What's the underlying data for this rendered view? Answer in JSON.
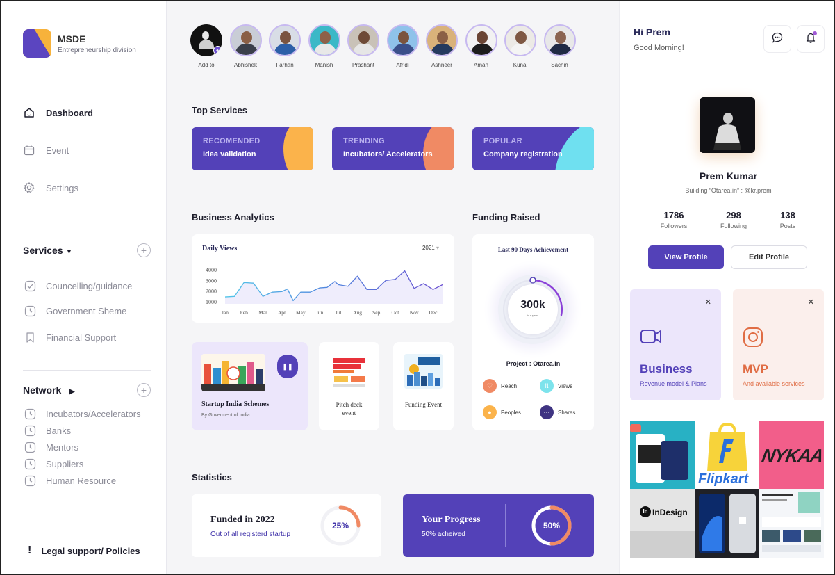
{
  "brand": {
    "title": "MSDE",
    "subtitle": "Entrepreneurship division"
  },
  "nav": {
    "dashboard": "Dashboard",
    "event": "Event",
    "settings": "Settings"
  },
  "services": {
    "title": "Services",
    "items": [
      "Councelling/guidance",
      "Government Sheme",
      "Financial Support"
    ]
  },
  "network": {
    "title": "Network",
    "items": [
      "Incubators/Accelerators",
      "Banks",
      "Mentors",
      "Suppliers",
      "Human Resource"
    ]
  },
  "legal": {
    "label": "Legal support/ Policies"
  },
  "stories": [
    "Add to",
    "Abhishek",
    "Farhan",
    "Manish",
    "Prashant",
    "Afridi",
    "Ashneer",
    "Aman",
    "Kunal",
    "Sachin"
  ],
  "top_services": {
    "title": "Top Services",
    "cards": [
      {
        "kind": "RECOMENDED",
        "value": "Idea validation"
      },
      {
        "kind": "TRENDING",
        "value": "Incubators/ Accelerators"
      },
      {
        "kind": "POPULAR",
        "value": "Company registration"
      }
    ]
  },
  "analytics": {
    "title": "Business Analytics"
  },
  "funding": {
    "title": "Funding Raised",
    "card_title": "Last 90 Days Achievement",
    "amount": "300k",
    "unit": "in rupees",
    "project": "Project : Otarea.in",
    "stats": [
      "Reach",
      "Views",
      "Peoples",
      "Shares"
    ]
  },
  "chart_data": {
    "type": "area",
    "title": "Daily Views",
    "year_selector": "2021",
    "x_ticks": [
      "Jan",
      "Feb",
      "Mar",
      "Apr",
      "May",
      "Jun",
      "Jul",
      "Aug",
      "Sep",
      "Oct",
      "Nov",
      "Dec"
    ],
    "y_ticks": [
      4000,
      3000,
      2000,
      1000
    ],
    "ylim": [
      800,
      4200
    ],
    "x": [
      0,
      0.5,
      1,
      1.5,
      2,
      2.5,
      3,
      3.3,
      3.6,
      4,
      4.5,
      5,
      5.4,
      5.8,
      6,
      6.5,
      7,
      7.5,
      8,
      8.5,
      9,
      9.5,
      10,
      10.5,
      11,
      11.5
    ],
    "values": [
      1450,
      1500,
      2800,
      2750,
      1500,
      1900,
      1950,
      2200,
      1100,
      1900,
      1900,
      2300,
      2350,
      2900,
      2600,
      2450,
      3400,
      2150,
      2150,
      3000,
      3100,
      3900,
      2250,
      2700,
      2150,
      2600
    ],
    "grid": false,
    "legend": "none"
  },
  "media": {
    "scheme_title": "Startup India Schemes",
    "scheme_sub": "By Goverment of India",
    "pitch_event": "Pitch deck event",
    "funding_event": "Funding Event"
  },
  "statistics": {
    "title": "Statistics",
    "funded": {
      "title": "Funded in 2022",
      "sub": "Out of all registerd startup",
      "percent_label": "25%",
      "percent": 25
    },
    "progress": {
      "title": "Your Progress",
      "sub": "50% acheived",
      "percent_label": "50%",
      "percent": 50
    }
  },
  "profile": {
    "greeting": "Hi Prem",
    "greeting_sub": "Good Morning!",
    "name": "Prem Kumar",
    "bio": "Building “Otarea.in” : @kr.prem",
    "followers": "1786",
    "followers_label": "Followers",
    "following": "298",
    "following_label": "Following",
    "posts": "138",
    "posts_label": "Posts",
    "view_btn": "View Profile",
    "edit_btn": "Edit Profile"
  },
  "features": [
    {
      "title": "Business",
      "sub": "Revenue model & Plans"
    },
    {
      "title": "MVP",
      "sub": "And available services"
    }
  ],
  "gallery": {
    "flipkart": "Flipkart",
    "nykaa": "NYKAA",
    "indesign": "InDesign",
    "indesign_prefix": "In"
  },
  "colors": {
    "primary": "#5341b8",
    "accent_orange": "#f08a64",
    "accent_yellow": "#fbb34b",
    "accent_cyan": "#6fe0f0"
  }
}
